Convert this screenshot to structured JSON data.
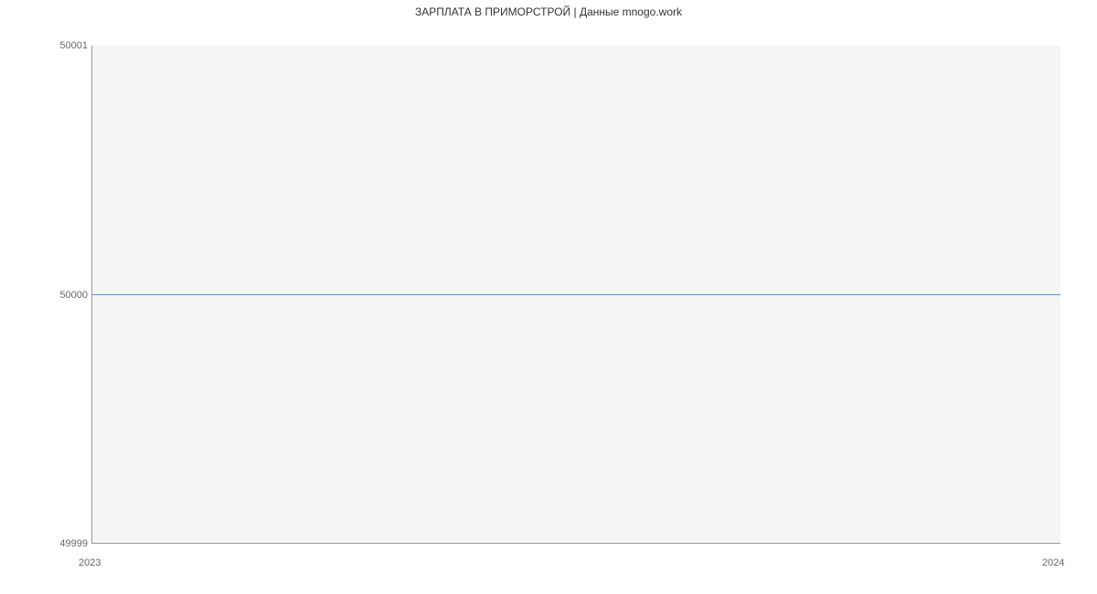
{
  "chart_data": {
    "type": "line",
    "title": "ЗАРПЛАТА В  ПРИМОРСТРОЙ | Данные mnogo.work",
    "x": [
      2023,
      2024
    ],
    "y": [
      50000,
      50000
    ],
    "xlabel": "",
    "ylabel": "",
    "ylim": [
      49999,
      50001
    ],
    "xlim": [
      2023,
      2024
    ],
    "y_ticks": [
      49999,
      50000,
      50001
    ],
    "x_ticks": [
      2023,
      2024
    ]
  }
}
